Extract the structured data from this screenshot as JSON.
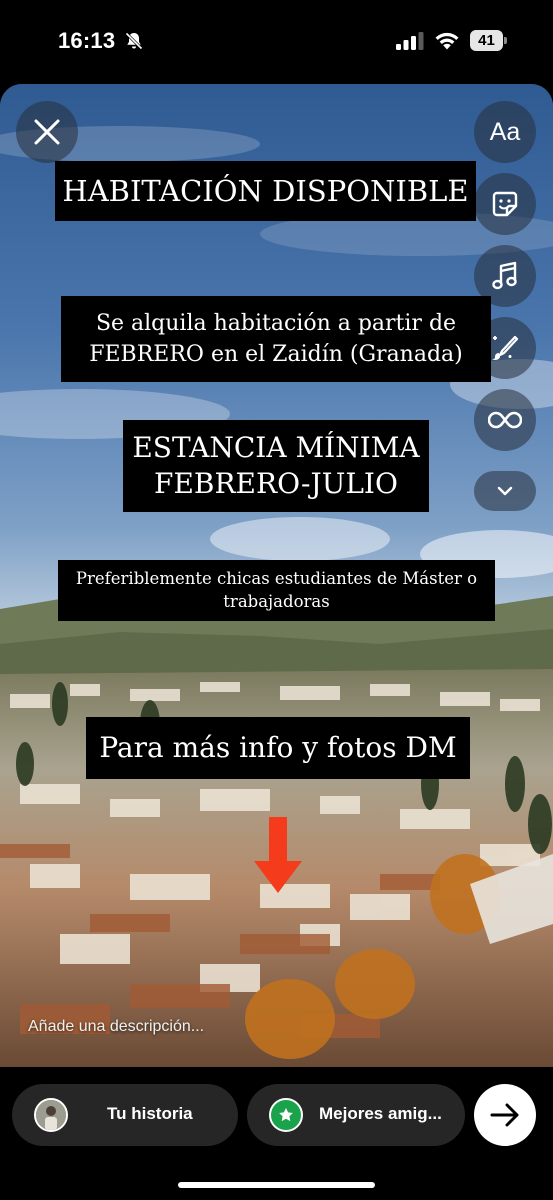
{
  "status_bar": {
    "time": "16:13",
    "battery": "41",
    "icons": [
      "bell-slash-icon",
      "signal-icon",
      "wifi-icon",
      "battery-icon"
    ]
  },
  "story": {
    "captions": [
      "HABITACIÓN DISPONIBLE",
      [
        "Se alquila habitación a partir de",
        "FEBRERO en el Zaidín (Granada)"
      ],
      [
        "ESTANCIA MÍNIMA",
        "FEBRERO-JULIO"
      ],
      [
        "Preferiblemente chicas estudiantes de Máster o",
        "trabajadoras"
      ],
      "Para más info y fotos DM"
    ],
    "description_placeholder": "Añade una descripción...",
    "tools": {
      "text_label": "Aa",
      "icons": [
        "close-icon",
        "text-icon",
        "sticker-icon",
        "music-icon",
        "draw-icon",
        "boomerang-icon",
        "chevron-down-icon"
      ]
    },
    "colors": {
      "caption_bg": "#000000",
      "arrow": "#f43c1c",
      "sky": "#3c6aa5"
    }
  },
  "share_bar": {
    "your_story_label": "Tu historia",
    "close_friends_label": "Mejores amig...",
    "send_icon": "arrow-right-icon",
    "colors": {
      "pill_bg": "#262626",
      "close_friends_green": "#1aa34a"
    }
  }
}
